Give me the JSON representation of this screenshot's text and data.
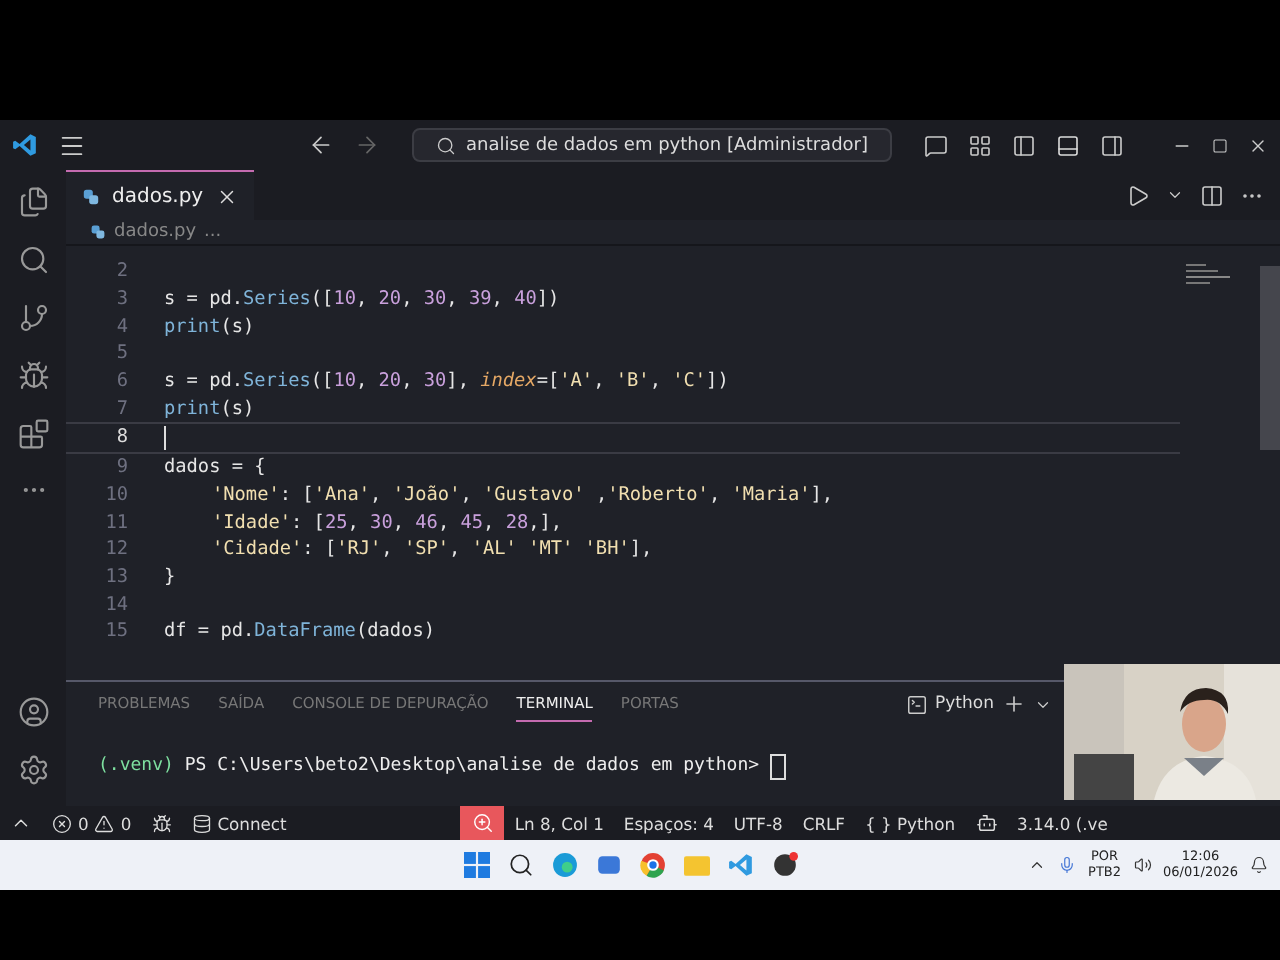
{
  "title_bar": {
    "search": "analise de dados em python [Administrador]"
  },
  "tabs": [
    {
      "label": "dados.py",
      "selected": true
    }
  ],
  "breadcrumb": {
    "file": "dados.py",
    "more": "..."
  },
  "editor": {
    "lines": [
      {
        "number": "2",
        "current": false
      },
      {
        "number": "3",
        "current": false,
        "tokens": [
          {
            "kind": "plain",
            "t": "s = pd."
          },
          {
            "kind": "func",
            "t": "Series"
          },
          {
            "kind": "plain",
            "t": "(["
          },
          {
            "kind": "num",
            "t": "10"
          },
          {
            "kind": "plain",
            "t": ", "
          },
          {
            "kind": "num",
            "t": "20"
          },
          {
            "kind": "plain",
            "t": ", "
          },
          {
            "kind": "num",
            "t": "30"
          },
          {
            "kind": "plain",
            "t": ", "
          },
          {
            "kind": "num",
            "t": "39"
          },
          {
            "kind": "plain",
            "t": ", "
          },
          {
            "kind": "num",
            "t": "40"
          },
          {
            "kind": "plain",
            "t": "])"
          }
        ]
      },
      {
        "number": "4",
        "current": false,
        "tokens": [
          {
            "kind": "func",
            "t": "print"
          },
          {
            "kind": "plain",
            "t": "(s)"
          }
        ]
      },
      {
        "number": "5",
        "current": false
      },
      {
        "number": "6",
        "current": false,
        "tokens": [
          {
            "kind": "plain",
            "t": "s = pd."
          },
          {
            "kind": "func",
            "t": "Series"
          },
          {
            "kind": "plain",
            "t": "(["
          },
          {
            "kind": "num",
            "t": "10"
          },
          {
            "kind": "plain",
            "t": ", "
          },
          {
            "kind": "num",
            "t": "20"
          },
          {
            "kind": "plain",
            "t": ", "
          },
          {
            "kind": "num",
            "t": "30"
          },
          {
            "kind": "plain",
            "t": "], "
          },
          {
            "kind": "param",
            "t": "index"
          },
          {
            "kind": "plain",
            "t": "=["
          },
          {
            "kind": "str",
            "t": "'A'"
          },
          {
            "kind": "plain",
            "t": ", "
          },
          {
            "kind": "str",
            "t": "'B'"
          },
          {
            "kind": "plain",
            "t": ", "
          },
          {
            "kind": "str",
            "t": "'C'"
          },
          {
            "kind": "plain",
            "t": "])"
          }
        ]
      },
      {
        "number": "7",
        "current": false,
        "tokens": [
          {
            "kind": "func",
            "t": "print"
          },
          {
            "kind": "plain",
            "t": "(s)"
          }
        ]
      },
      {
        "number": "8",
        "current": true
      },
      {
        "number": "9",
        "current": false,
        "tokens": [
          {
            "kind": "plain",
            "t": "dados = {"
          }
        ],
        "children": [
          {
            "number": "10",
            "current": false,
            "tokens": [
              {
                "kind": "str",
                "t": "'Nome'"
              },
              {
                "kind": "plain",
                "t": ": ["
              },
              {
                "kind": "str",
                "t": "'Ana'"
              },
              {
                "kind": "plain",
                "t": ", "
              },
              {
                "kind": "str",
                "t": "'João'"
              },
              {
                "kind": "plain",
                "t": ", "
              },
              {
                "kind": "str",
                "t": "'Gustavo' "
              },
              {
                "kind": "plain",
                "t": ","
              },
              {
                "kind": "str",
                "t": "'Roberto'"
              },
              {
                "kind": "plain",
                "t": ", "
              },
              {
                "kind": "str",
                "t": "'Maria'"
              },
              {
                "kind": "plain",
                "t": "],"
              }
            ]
          },
          {
            "number": "11",
            "current": false,
            "tokens": [
              {
                "kind": "str",
                "t": "'Idade'"
              },
              {
                "kind": "plain",
                "t": ": ["
              },
              {
                "kind": "num",
                "t": "25"
              },
              {
                "kind": "plain",
                "t": ", "
              },
              {
                "kind": "num",
                "t": "30"
              },
              {
                "kind": "plain",
                "t": ", "
              },
              {
                "kind": "num",
                "t": "46"
              },
              {
                "kind": "plain",
                "t": ", "
              },
              {
                "kind": "num",
                "t": "45"
              },
              {
                "kind": "plain",
                "t": ", "
              },
              {
                "kind": "num",
                "t": "28"
              },
              {
                "kind": "plain",
                "t": ",],"
              }
            ]
          },
          {
            "number": "12",
            "current": false,
            "tokens": [
              {
                "kind": "str",
                "t": "'Cidade'"
              },
              {
                "kind": "plain",
                "t": ": ["
              },
              {
                "kind": "str",
                "t": "'RJ'"
              },
              {
                "kind": "plain",
                "t": ", "
              },
              {
                "kind": "str",
                "t": "'SP'"
              },
              {
                "kind": "plain",
                "t": ", "
              },
              {
                "kind": "str",
                "t": "'AL' 'MT' 'BH'"
              },
              {
                "kind": "plain",
                "t": "],"
              }
            ]
          }
        ]
      },
      {
        "number": "13",
        "current": false,
        "tokens": [
          {
            "kind": "plain",
            "t": "}"
          }
        ]
      },
      {
        "number": "14",
        "current": false
      },
      {
        "number": "15",
        "current": false,
        "tokens": [
          {
            "kind": "plain",
            "t": "df = pd."
          },
          {
            "kind": "func",
            "t": "DataFrame"
          },
          {
            "kind": "plain",
            "t": "(dados)"
          }
        ]
      }
    ]
  },
  "panel_tabs": [
    {
      "label": "PROBLEMAS",
      "selected": false
    },
    {
      "label": "SAÍDA",
      "selected": false
    },
    {
      "label": "CONSOLE DE DEPURAÇÃO",
      "selected": false
    },
    {
      "label": "TERMINAL",
      "selected": true
    },
    {
      "label": "PORTAS",
      "selected": false
    }
  ],
  "terminal_profile": "Python",
  "terminal": {
    "env": "(.venv)",
    "prompt": "PS C:\\Users\\beto2\\Desktop\\analise de dados em python>"
  },
  "status_bar": {
    "errors": "0",
    "warnings": "0",
    "connect": "Connect",
    "items": [
      "Ln 8, Col 1",
      "Espaços: 4",
      "UTF-8",
      "CRLF",
      "{ } Python"
    ],
    "version": "3.14.0 (.ve"
  },
  "taskbar": {
    "language": "POR",
    "layout": "PTB2",
    "time": "12:06",
    "date": "06/01/2026"
  }
}
